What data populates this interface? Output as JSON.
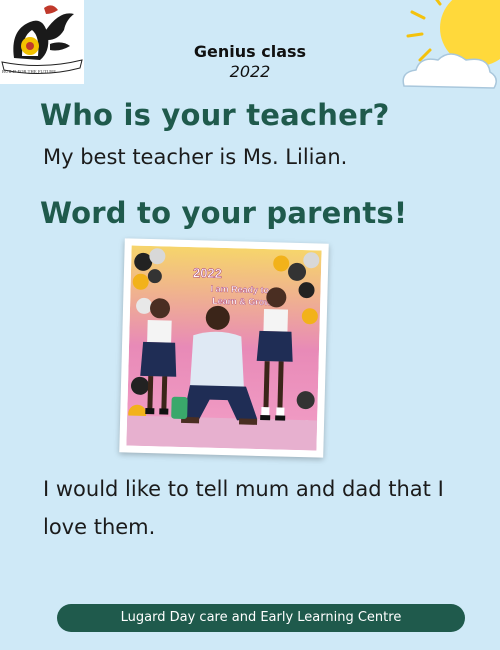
{
  "logo": {
    "motto": "BUILD FOR THE FUTURE"
  },
  "header": {
    "class_name": "Genius class",
    "year": "2022"
  },
  "questions": [
    {
      "heading": "Who is your teacher?",
      "answer": "My best teacher is Ms. Lilian."
    },
    {
      "heading": "Word to your parents!",
      "answer": "I would like to tell mum and dad that I love them."
    }
  ],
  "photo": {
    "banner_line1": "2022",
    "banner_line2": "I am Ready to",
    "banner_line3": "Learn & Grow"
  },
  "footer": {
    "label": "Lugard Day care and Early Learning Centre"
  },
  "colors": {
    "background": "#cfe9f7",
    "heading": "#1f5a4c",
    "footer_bg": "#1f5a4c"
  }
}
